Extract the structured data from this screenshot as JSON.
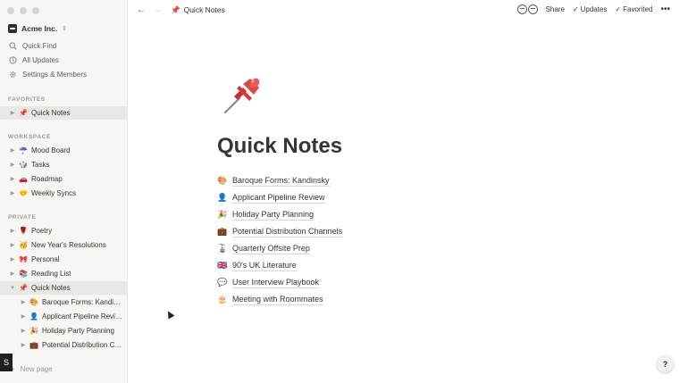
{
  "workspace": {
    "name": "Acme Inc.",
    "switch_icon": "⇕"
  },
  "sidebar_nav": [
    {
      "label": "Quick Find",
      "icon": "search-icon"
    },
    {
      "label": "All Updates",
      "icon": "clock-icon"
    },
    {
      "label": "Settings & Members",
      "icon": "gear-icon"
    }
  ],
  "sections": {
    "favorites": "FAVORITES",
    "workspace": "WORKSPACE",
    "private": "PRIVATE"
  },
  "favorites": [
    {
      "emoji": "📌",
      "label": "Quick Notes",
      "active": true
    }
  ],
  "workspace_pages": [
    {
      "emoji": "☂️",
      "label": "Mood Board"
    },
    {
      "emoji": "🎲",
      "label": "Tasks"
    },
    {
      "emoji": "🚗",
      "label": "Roadmap"
    },
    {
      "emoji": "🤝",
      "label": "Weekly Syncs"
    }
  ],
  "private_pages": [
    {
      "emoji": "🌹",
      "label": "Poetry"
    },
    {
      "emoji": "🥳",
      "label": "New Year's Resolutions"
    },
    {
      "emoji": "🎀",
      "label": "Personal"
    },
    {
      "emoji": "📚",
      "label": "Reading List"
    },
    {
      "emoji": "📌",
      "label": "Quick Notes",
      "active": true,
      "expanded": true
    }
  ],
  "sub_pages": [
    {
      "emoji": "🎨",
      "label": "Baroque Forms: Kandinsky"
    },
    {
      "emoji": "👤",
      "label": "Applicant Pipeline Review"
    },
    {
      "emoji": "🎉",
      "label": "Holiday Party Planning"
    },
    {
      "emoji": "💼",
      "label": "Potential Distribution Channels"
    }
  ],
  "new_page_label": "New page",
  "overlay_badge": "S",
  "topbar": {
    "back": "←",
    "forward": "→",
    "breadcrumb_emoji": "📌",
    "breadcrumb_label": "Quick Notes",
    "share_label": "Share",
    "updates_label": "Updates",
    "favorited_label": "Favorited",
    "more": "•••"
  },
  "page": {
    "title": "Quick Notes",
    "links": [
      {
        "emoji": "🎨",
        "label": "Baroque Forms: Kandinsky"
      },
      {
        "emoji": "👤",
        "label": "Applicant Pipeline Review"
      },
      {
        "emoji": "🎉",
        "label": "Holiday Party Planning"
      },
      {
        "emoji": "💼",
        "label": "Potential Distribution Channels"
      },
      {
        "emoji": "🚡",
        "label": "Quarterly Offsite Prep"
      },
      {
        "emoji": "🇬🇧",
        "label": "90's UK Literature"
      },
      {
        "emoji": "💬",
        "label": "User Interview Playbook"
      },
      {
        "emoji": "🎂",
        "label": "Meeting with Roommates"
      }
    ]
  },
  "help_label": "?",
  "colors": {
    "sidebar_bg": "#f7f6f3",
    "active_bg": "#e9e8e5",
    "text": "#37352f",
    "muted": "#9b9a97",
    "pin_red": "#d63b3b"
  }
}
